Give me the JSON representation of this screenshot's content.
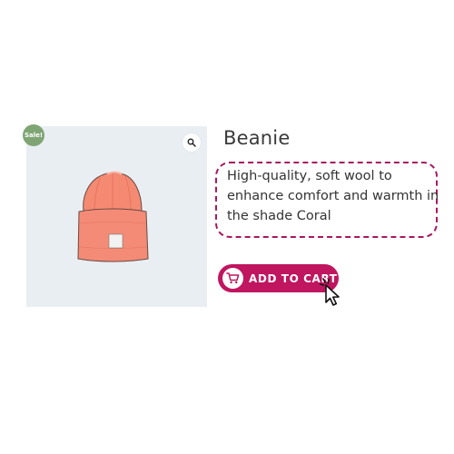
{
  "product": {
    "sale_badge": "Sale!",
    "title": "Beanie",
    "description": "High-quality, soft wool to enhance comfort and warmth in the shade Coral",
    "add_to_cart_label": "ADD TO CART"
  },
  "icons": {
    "zoom": "magnifier-icon",
    "cart": "shopping-cart-icon",
    "cursor": "pointer-cursor-icon"
  },
  "colors": {
    "accent": "#c0155f",
    "sale_badge": "#7fa574",
    "image_background": "#e9eef3",
    "beanie": "#f4856f"
  }
}
